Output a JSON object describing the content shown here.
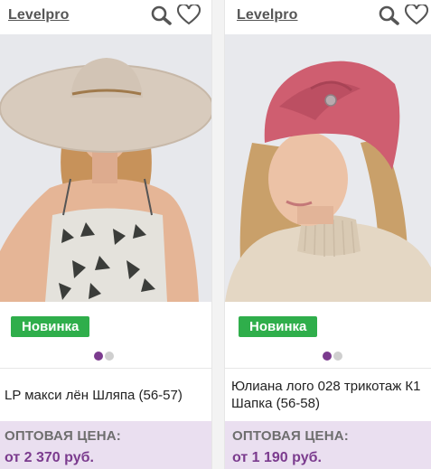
{
  "products": [
    {
      "brand": "Levelpro",
      "badge": "Новинка",
      "title": "LP макси лён Шляпа (56-57)",
      "price_label": "ОПТОВАЯ ЦЕНА:",
      "price": "от 2 370 руб.",
      "image": "woman-in-wide-brim-linen-hat",
      "carousel": {
        "count": 2,
        "active": 0
      }
    },
    {
      "brand": "Levelpro",
      "badge": "Новинка",
      "title": "Юлиана лого 028 трикотаж К1 Шапка (56-58)",
      "price_label": "ОПТОВАЯ ЦЕНА:",
      "price": "от 1 190 руб.",
      "image": "woman-in-pink-knit-turban-hat",
      "carousel": {
        "count": 2,
        "active": 0
      }
    }
  ],
  "icons": {
    "search": "search-icon",
    "favorite": "heart-icon"
  },
  "colors": {
    "badge": "#2fae4b",
    "accent": "#7b3b8e",
    "price_bg": "#eadff0"
  }
}
